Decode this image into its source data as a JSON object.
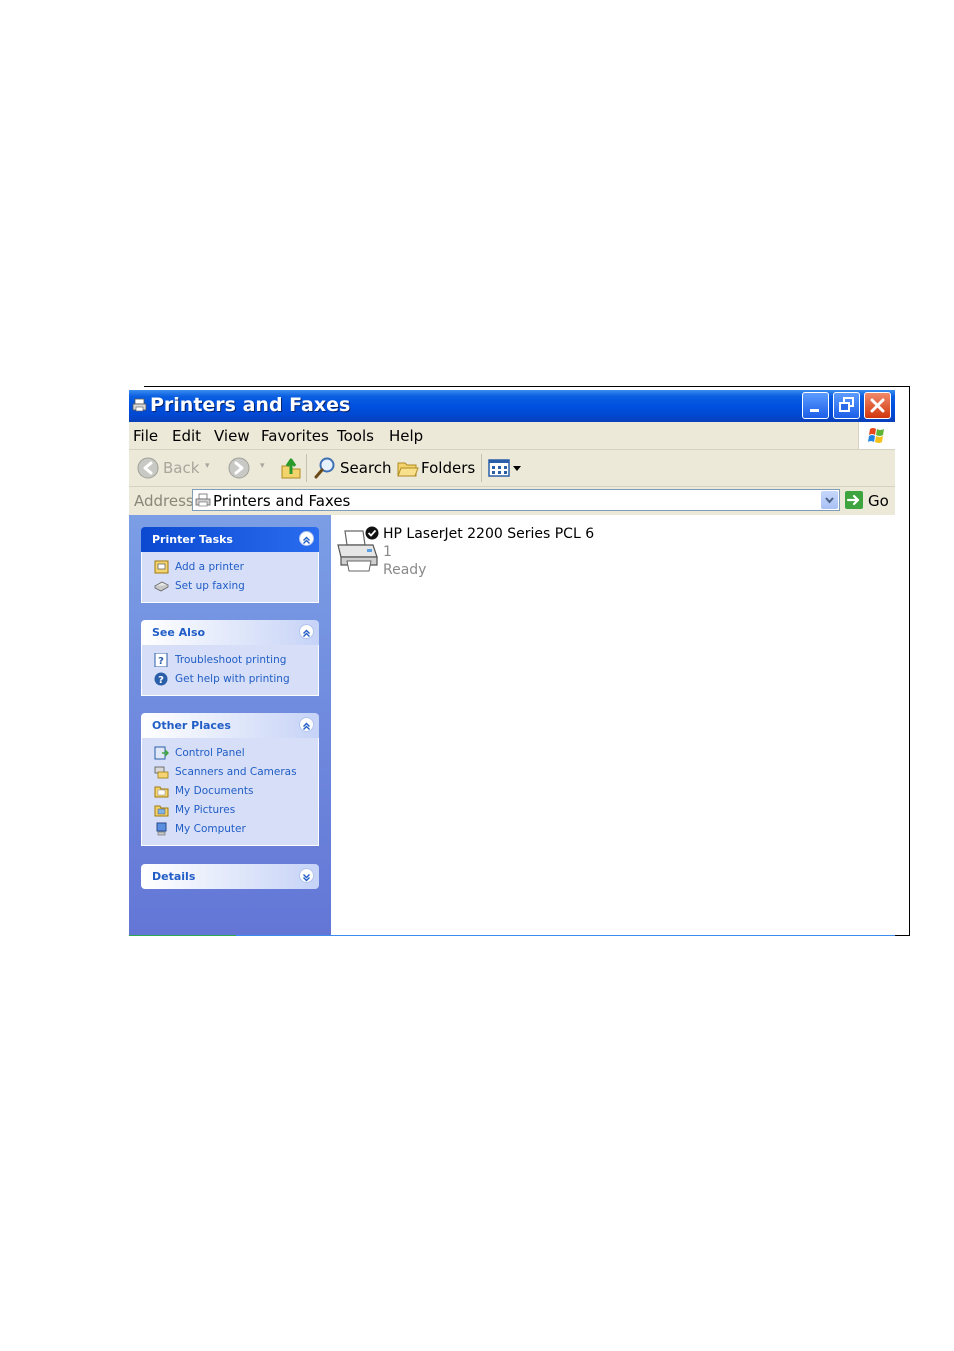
{
  "window": {
    "title": "Printers and Faxes"
  },
  "menu": {
    "items": [
      "File",
      "Edit",
      "View",
      "Favorites",
      "Tools",
      "Help"
    ]
  },
  "toolbar": {
    "back_label": "Back",
    "search_label": "Search",
    "folders_label": "Folders"
  },
  "address": {
    "label": "Address",
    "value": "Printers and Faxes",
    "go_label": "Go"
  },
  "left_pane": {
    "printer_tasks": {
      "title": "Printer Tasks",
      "links": [
        "Add a printer",
        "Set up faxing"
      ]
    },
    "see_also": {
      "title": "See Also",
      "links": [
        "Troubleshoot printing",
        "Get help with printing"
      ]
    },
    "other_places": {
      "title": "Other Places",
      "links": [
        "Control Panel",
        "Scanners and Cameras",
        "My Documents",
        "My Pictures",
        "My Computer"
      ]
    },
    "details": {
      "title": "Details"
    }
  },
  "printers": [
    {
      "name": "HP LaserJet 2200 Series PCL 6",
      "jobs": "1",
      "status": "Ready",
      "is_default": true
    }
  ],
  "icons": [
    "printer-icon",
    "default-check-icon",
    "back-arrow-icon",
    "forward-arrow-icon",
    "up-folder-icon",
    "search-icon",
    "folders-icon",
    "views-icon",
    "go-arrow-icon",
    "windows-logo-icon"
  ],
  "colors": {
    "titlebar": "#0050e0",
    "task_link": "#215dc6",
    "left_pane": "#7b9ee5"
  }
}
